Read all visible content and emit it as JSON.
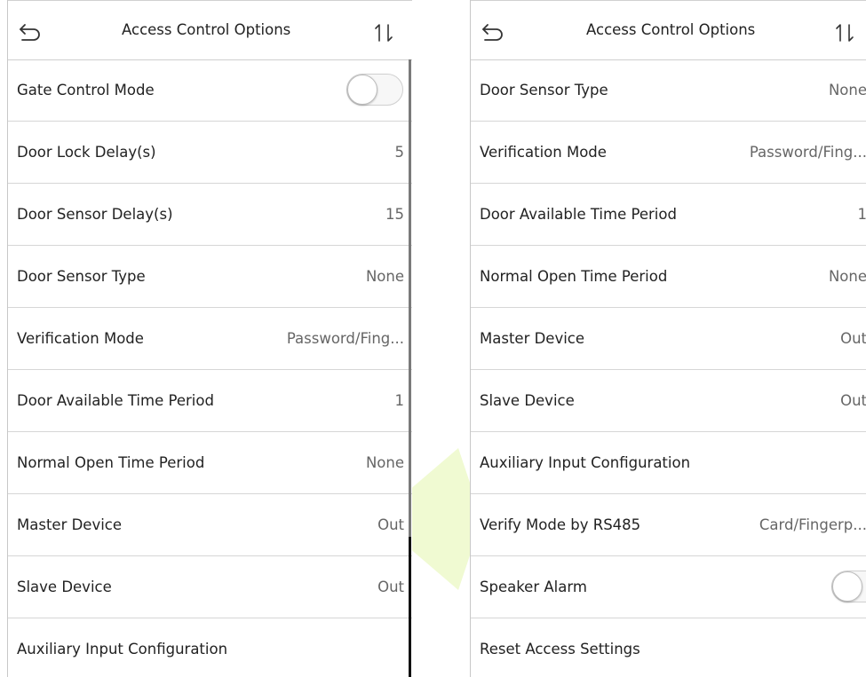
{
  "left_panel": {
    "title": "Access Control Options",
    "rows": [
      {
        "label": "Gate Control Mode",
        "value": ""
      },
      {
        "label": "Door Lock Delay(s)",
        "value": "5"
      },
      {
        "label": "Door Sensor Delay(s)",
        "value": "15"
      },
      {
        "label": "Door Sensor Type",
        "value": "None"
      },
      {
        "label": "Verification Mode",
        "value": "Password/Fing..."
      },
      {
        "label": "Door Available Time Period",
        "value": "1"
      },
      {
        "label": "Normal Open Time Period",
        "value": "None"
      },
      {
        "label": "Master Device",
        "value": "Out"
      },
      {
        "label": "Slave Device",
        "value": "Out"
      },
      {
        "label": "Auxiliary Input Configuration",
        "value": ""
      }
    ]
  },
  "right_panel": {
    "title": "Access Control Options",
    "rows": [
      {
        "label": "Door Sensor Type",
        "value": "None"
      },
      {
        "label": "Verification Mode",
        "value": "Password/Fing..."
      },
      {
        "label": "Door Available Time Period",
        "value": "1"
      },
      {
        "label": "Normal Open Time Period",
        "value": "None"
      },
      {
        "label": "Master Device",
        "value": "Out"
      },
      {
        "label": "Slave Device",
        "value": "Out"
      },
      {
        "label": "Auxiliary Input Configuration",
        "value": ""
      },
      {
        "label": "Verify Mode by RS485",
        "value": "Card/Fingerp..."
      },
      {
        "label": "Speaker Alarm",
        "value": ""
      },
      {
        "label": "Reset Access Settings",
        "value": ""
      }
    ]
  },
  "toggles": {
    "gate_control_mode": false,
    "speaker_alarm": false
  },
  "icons": {
    "back": "back-arrow-icon",
    "sort": "sort-icon"
  },
  "colors": {
    "arrow": "#eef9c9",
    "divider": "#d6d6d6",
    "value_text": "#666666"
  }
}
